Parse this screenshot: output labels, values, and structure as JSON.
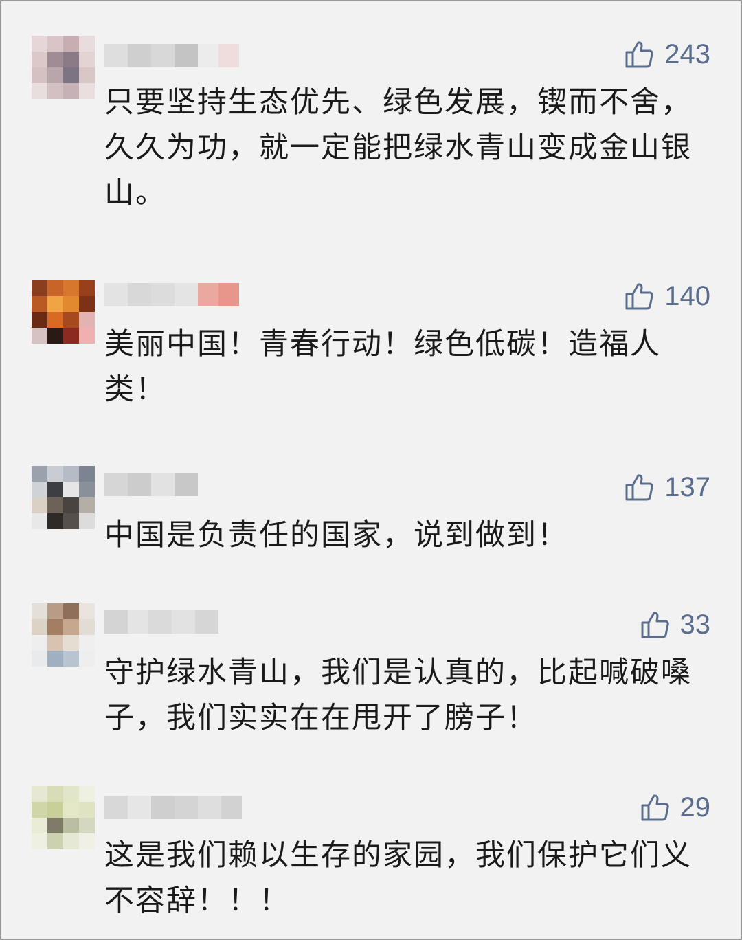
{
  "comments": [
    {
      "likes": "243",
      "text": "只要坚持生态优先、绿色发展，锲而不舍，久久为功，就一定能把绿水青山变成金山银山。"
    },
    {
      "likes": "140",
      "text": "美丽中国！青春行动！绿色低碳！造福人类！"
    },
    {
      "likes": "137",
      "text": "中国是负责任的国家，说到做到！"
    },
    {
      "likes": "33",
      "text": "守护绿水青山，我们是认真的，比起喊破嗓子，我们实实在在甩开了膀子！"
    },
    {
      "likes": "29",
      "text": "这是我们赖以生存的家园，我们保护它们义不容辞！！！"
    }
  ],
  "icons": {
    "like": "thumbs-up-icon"
  },
  "colors": {
    "like_blue": "#5a6d8c",
    "text": "#1a1a1a",
    "background": "#f2f2f2"
  }
}
